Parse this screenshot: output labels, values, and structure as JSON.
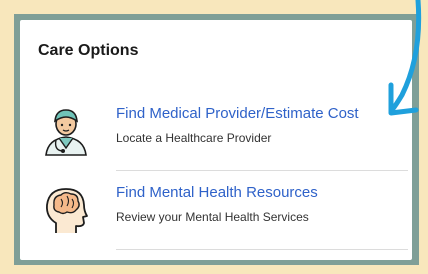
{
  "card": {
    "title": "Care Options"
  },
  "options": [
    {
      "title": "Find Medical Provider/Estimate Cost",
      "subtitle": "Locate a Healthcare Provider",
      "icon": "doctor-icon"
    },
    {
      "title": "Find Mental Health Resources",
      "subtitle": "Review your Mental Health Services",
      "icon": "head-brain-icon"
    }
  ],
  "colors": {
    "background": "#f8e7bc",
    "frame": "#7f9f97",
    "link": "#2f62c9",
    "arrow": "#1fa0dc"
  }
}
